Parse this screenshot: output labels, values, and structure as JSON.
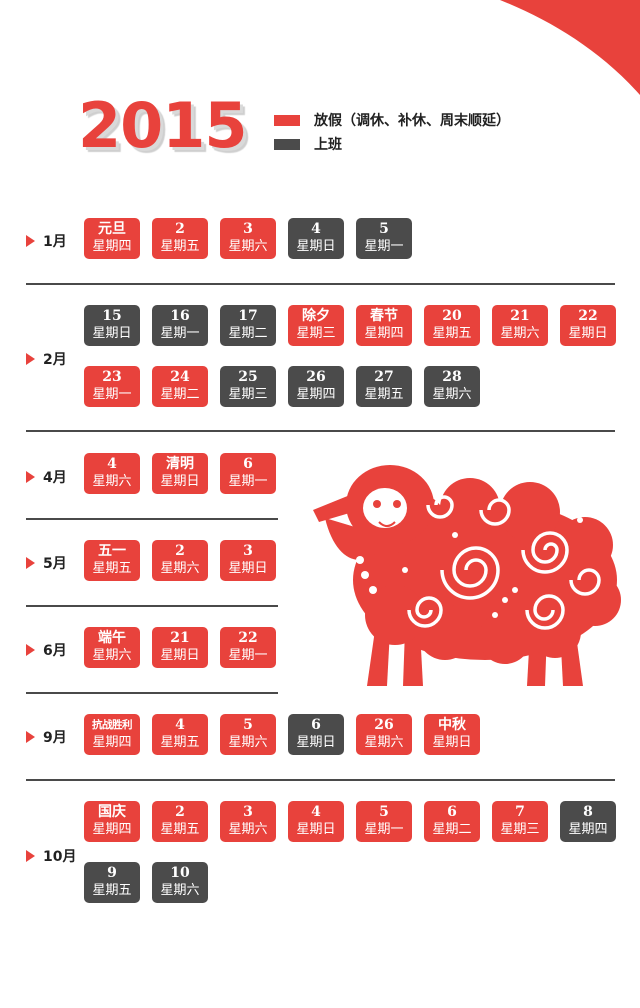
{
  "year": "2015",
  "legend": {
    "holiday": {
      "label": "放假（调休、补休、周末顺延）",
      "color": "#e8423c"
    },
    "work": {
      "label": "上班",
      "color": "#4b4b4b"
    }
  },
  "months": [
    {
      "label": "1月",
      "rows": [
        [
          {
            "t": "元旦",
            "w": "星期四",
            "s": "holiday"
          },
          {
            "t": "2",
            "w": "星期五",
            "s": "holiday"
          },
          {
            "t": "3",
            "w": "星期六",
            "s": "holiday"
          },
          {
            "t": "4",
            "w": "星期日",
            "s": "work"
          },
          {
            "t": "5",
            "w": "星期一",
            "s": "work"
          }
        ]
      ]
    },
    {
      "label": "2月",
      "rows": [
        [
          {
            "t": "15",
            "w": "星期日",
            "s": "work"
          },
          {
            "t": "16",
            "w": "星期一",
            "s": "work"
          },
          {
            "t": "17",
            "w": "星期二",
            "s": "work"
          },
          {
            "t": "除夕",
            "w": "星期三",
            "s": "holiday"
          },
          {
            "t": "春节",
            "w": "星期四",
            "s": "holiday"
          },
          {
            "t": "20",
            "w": "星期五",
            "s": "holiday"
          },
          {
            "t": "21",
            "w": "星期六",
            "s": "holiday"
          },
          {
            "t": "22",
            "w": "星期日",
            "s": "holiday"
          }
        ],
        [
          {
            "t": "23",
            "w": "星期一",
            "s": "holiday"
          },
          {
            "t": "24",
            "w": "星期二",
            "s": "holiday"
          },
          {
            "t": "25",
            "w": "星期三",
            "s": "work"
          },
          {
            "t": "26",
            "w": "星期四",
            "s": "work"
          },
          {
            "t": "27",
            "w": "星期五",
            "s": "work"
          },
          {
            "t": "28",
            "w": "星期六",
            "s": "work"
          }
        ]
      ]
    },
    {
      "label": "4月",
      "rows": [
        [
          {
            "t": "4",
            "w": "星期六",
            "s": "holiday"
          },
          {
            "t": "清明",
            "w": "星期日",
            "s": "holiday"
          },
          {
            "t": "6",
            "w": "星期一",
            "s": "holiday"
          }
        ]
      ]
    },
    {
      "label": "5月",
      "rows": [
        [
          {
            "t": "五一",
            "w": "星期五",
            "s": "holiday"
          },
          {
            "t": "2",
            "w": "星期六",
            "s": "holiday"
          },
          {
            "t": "3",
            "w": "星期日",
            "s": "holiday"
          }
        ]
      ]
    },
    {
      "label": "6月",
      "rows": [
        [
          {
            "t": "端午",
            "w": "星期六",
            "s": "holiday"
          },
          {
            "t": "21",
            "w": "星期日",
            "s": "holiday"
          },
          {
            "t": "22",
            "w": "星期一",
            "s": "holiday"
          }
        ]
      ]
    },
    {
      "label": "9月",
      "rows": [
        [
          {
            "t": "抗战胜利",
            "w": "星期四",
            "s": "holiday"
          },
          {
            "t": "4",
            "w": "星期五",
            "s": "holiday"
          },
          {
            "t": "5",
            "w": "星期六",
            "s": "holiday"
          },
          {
            "t": "6",
            "w": "星期日",
            "s": "work"
          },
          {
            "t": "26",
            "w": "星期六",
            "s": "holiday"
          },
          {
            "t": "中秋",
            "w": "星期日",
            "s": "holiday"
          }
        ]
      ]
    },
    {
      "label": "10月",
      "rows": [
        [
          {
            "t": "国庆",
            "w": "星期四",
            "s": "holiday"
          },
          {
            "t": "2",
            "w": "星期五",
            "s": "holiday"
          },
          {
            "t": "3",
            "w": "星期六",
            "s": "holiday"
          },
          {
            "t": "4",
            "w": "星期日",
            "s": "holiday"
          },
          {
            "t": "5",
            "w": "星期一",
            "s": "holiday"
          },
          {
            "t": "6",
            "w": "星期二",
            "s": "holiday"
          },
          {
            "t": "7",
            "w": "星期三",
            "s": "holiday"
          },
          {
            "t": "8",
            "w": "星期四",
            "s": "work"
          }
        ],
        [
          {
            "t": "9",
            "w": "星期五",
            "s": "work"
          },
          {
            "t": "10",
            "w": "星期六",
            "s": "work"
          }
        ]
      ]
    }
  ],
  "icons": {
    "corner": "corner-swoosh-icon",
    "sheep": "papercut-sheep-icon",
    "month_marker": "triangle-marker-icon"
  }
}
